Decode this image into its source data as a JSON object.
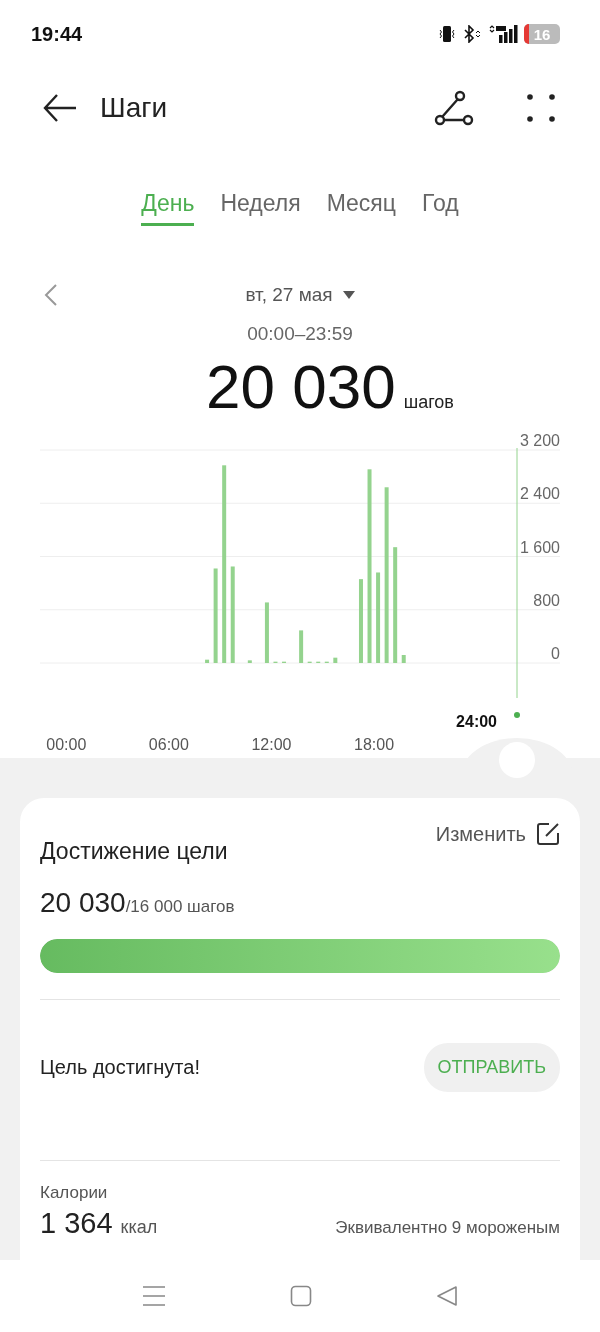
{
  "status_bar": {
    "time": "19:44",
    "battery": "16"
  },
  "header": {
    "title": "Шаги"
  },
  "tabs": [
    {
      "label": "День",
      "selected": true
    },
    {
      "label": "Неделя",
      "selected": false
    },
    {
      "label": "Месяц",
      "selected": false
    },
    {
      "label": "Год",
      "selected": false
    }
  ],
  "date": {
    "label": "вт, 27 мая",
    "range": "00:00–23:59"
  },
  "total": {
    "value": "20 030",
    "unit": "шагов"
  },
  "chart": {
    "current_label": "24:00",
    "chart_data": {
      "type": "bar",
      "grid": true,
      "categories": [
        "00:00",
        null,
        null,
        null,
        null,
        null,
        null,
        null,
        null,
        null,
        null,
        null,
        "06:00",
        null,
        null,
        null,
        null,
        null,
        null,
        null,
        null,
        null,
        null,
        null,
        "12:00",
        null,
        null,
        null,
        null,
        null,
        null,
        null,
        null,
        null,
        null,
        null,
        "18:00",
        null,
        null,
        null,
        null,
        null,
        null,
        null,
        null,
        null,
        null,
        null
      ],
      "values": [
        null,
        null,
        null,
        null,
        null,
        null,
        null,
        null,
        null,
        null,
        null,
        null,
        null,
        null,
        null,
        null,
        50,
        1420,
        2970,
        1450,
        null,
        40,
        null,
        910,
        20,
        20,
        null,
        490,
        20,
        20,
        20,
        80,
        null,
        null,
        1260,
        2910,
        1360,
        2640,
        1740,
        120,
        null,
        null,
        null,
        null,
        null,
        null,
        null,
        null
      ],
      "ylim": [
        0,
        3200
      ],
      "yticks": [
        {
          "value": 0,
          "label": "0"
        },
        {
          "value": 800,
          "label": "800"
        },
        {
          "value": 1600,
          "label": "1 600"
        },
        {
          "value": 2400,
          "label": "2 400"
        },
        {
          "value": 3200,
          "label": "3 200"
        }
      ]
    }
  },
  "goal": {
    "title": "Достижение цели",
    "edit": "Изменить",
    "value": "20 030",
    "target": "/16 000 шагов",
    "level": 1,
    "message": "Цель достигнута!",
    "send": "ОТПРАВИТЬ"
  },
  "calories": {
    "label": "Калории",
    "value": "1 364",
    "unit": "ккал",
    "note": "Эквивалентно 9 мороженым"
  }
}
